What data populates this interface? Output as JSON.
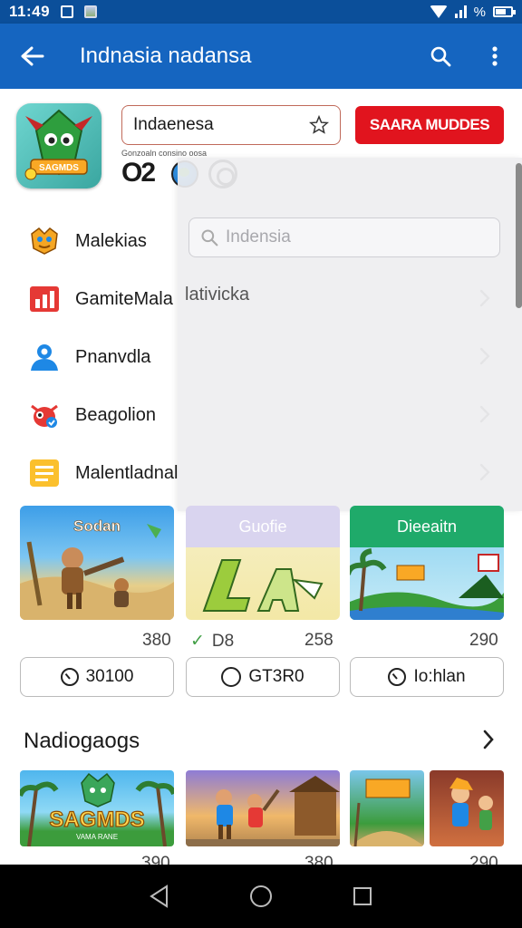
{
  "status": {
    "time": "11:49",
    "battery_text": "%"
  },
  "appbar": {
    "title": "Indnasia nadansa"
  },
  "header": {
    "search_value": "Indaenesa",
    "red_button": "SAARA MUDDES",
    "rating_tiny": "Gonzoaln  consino  oosa",
    "rating_big": "O2"
  },
  "menu": [
    {
      "label": "Malekias",
      "icon": "game-character-icon",
      "color": "#f5a623"
    },
    {
      "label": "GamiteMala",
      "icon": "chart-icon",
      "color": "#e53935"
    },
    {
      "label": "Pnanvdla",
      "icon": "person-icon",
      "color": "#1e88e5"
    },
    {
      "label": "Beagolion",
      "icon": "bug-icon",
      "color": "#e53935"
    },
    {
      "label": "Malentladnal",
      "icon": "notes-icon",
      "color": "#fbc02d"
    }
  ],
  "overlay": {
    "placeholder": "Indensia",
    "ghost_text": "lativicka"
  },
  "cards": [
    {
      "header": "Sodan",
      "header_bg": "",
      "header_color": "#fff",
      "count": "380",
      "pill": "30100",
      "pill_icon": "clock-icon"
    },
    {
      "header": "Guofie",
      "header_bg": "#d9d4ef",
      "header_color": "#fff",
      "count_left": "D8",
      "count": "258",
      "pill": "GT3R0",
      "pill_icon": "ring-icon"
    },
    {
      "header": "Dieeaitn",
      "header_bg": "#1faa6a",
      "header_color": "#fff",
      "count": "290",
      "pill": "Io:hlan",
      "pill_icon": "clock-icon"
    }
  ],
  "section": {
    "title": "Nadiogaogs"
  },
  "bottom": [
    {
      "label": "SAGMDS",
      "sub": "VAMA RANE",
      "count": "390"
    },
    {
      "label": "",
      "count": "380"
    },
    {
      "label": "",
      "count": "290"
    }
  ]
}
